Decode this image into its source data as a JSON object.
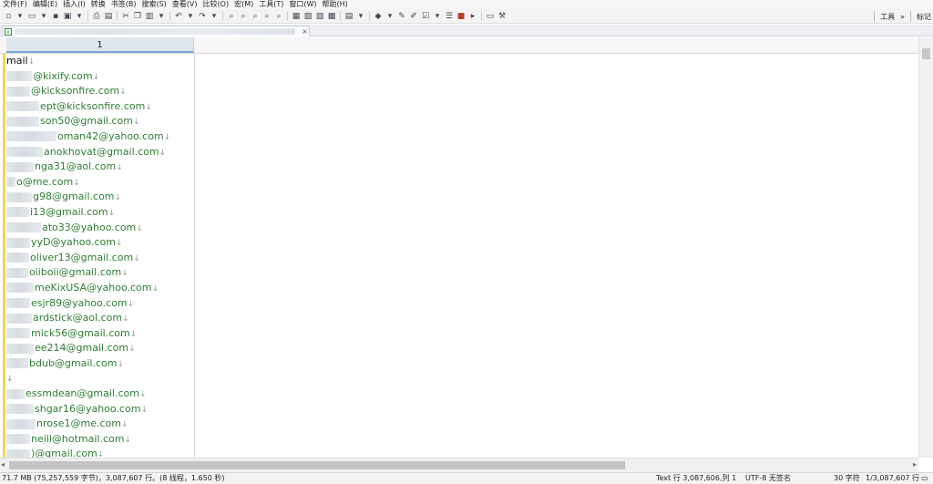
{
  "menu": [
    "文件(F)",
    "编辑(E)",
    "插入(I)",
    "转换",
    "书签(B)",
    "搜索(S)",
    "查看(V)",
    "比较(O)",
    "宏(M)",
    "工具(T)",
    "窗口(W)",
    "帮助(H)"
  ],
  "toolbar_right": {
    "tools": "工具",
    "more": "»",
    "mark": "标记"
  },
  "tab": {
    "close": "×"
  },
  "column_header": "1",
  "cells": [
    {
      "mask": 0,
      "text": "mail"
    },
    {
      "mask": 28,
      "text": "@kixify.com"
    },
    {
      "mask": 26,
      "text": "@kicksonfire.com"
    },
    {
      "mask": 36,
      "text": "ept@kicksonfire.com"
    },
    {
      "mask": 36,
      "text": "son50@gmail.com"
    },
    {
      "mask": 55,
      "text": "oman42@yahoo.com"
    },
    {
      "mask": 40,
      "text": "anokhovat@gmail.com"
    },
    {
      "mask": 30,
      "text": "nga31@aol.com"
    },
    {
      "mask": 10,
      "text": "o@me.com"
    },
    {
      "mask": 28,
      "text": "g98@gmail.com"
    },
    {
      "mask": 25,
      "text": "i13@gmail.com"
    },
    {
      "mask": 38,
      "text": "ato33@yahoo.com"
    },
    {
      "mask": 26,
      "text": "yyD@yahoo.com"
    },
    {
      "mask": 25,
      "text": "oliver13@gmail.com"
    },
    {
      "mask": 24,
      "text": "oiiboii@gmail.com"
    },
    {
      "mask": 30,
      "text": "meKixUSA@yahoo.com"
    },
    {
      "mask": 26,
      "text": "esjr89@yahoo.com"
    },
    {
      "mask": 28,
      "text": "ardstick@aol.com"
    },
    {
      "mask": 26,
      "text": "mick56@gmail.com"
    },
    {
      "mask": 30,
      "text": "ee214@gmail.com"
    },
    {
      "mask": 24,
      "text": "bdub@gmail.com"
    },
    {
      "mask": 0,
      "text": ""
    },
    {
      "mask": 20,
      "text": "essmdean@gmail.com"
    },
    {
      "mask": 30,
      "text": "shgar16@yahoo.com"
    },
    {
      "mask": 32,
      "text": "nrose1@me.com"
    },
    {
      "mask": 26,
      "text": "neill@hotmail.com"
    },
    {
      "mask": 26,
      "text": ")@gmail.com"
    }
  ],
  "newline_glyph": "↓",
  "status": {
    "file_info": "71.7 MB (75,257,559 字节)，3,087,607 行。(8 线程，1.650 秒)",
    "position": "Text  行 3,087,606,列 1",
    "encoding": "UTF-8 无签名",
    "chars": "30 字符",
    "lines": "1/3,087,607 行"
  },
  "colors": {
    "accent_text": "#2e7d32",
    "row_marker": "#f2d64a",
    "column_header_active": "#dfe6ee"
  }
}
